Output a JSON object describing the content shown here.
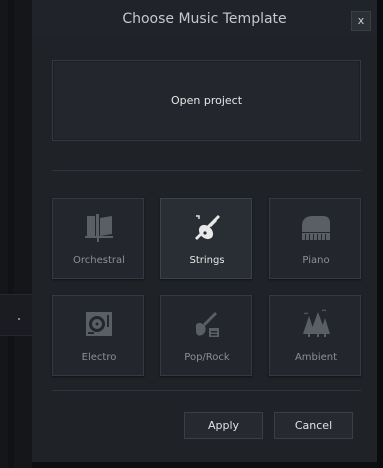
{
  "dialog": {
    "title": "Choose Music Template",
    "close_label": "x",
    "open_project_label": "Open project"
  },
  "templates": [
    {
      "label": "Orchestral",
      "icon": "orchestral-icon",
      "selected": false
    },
    {
      "label": "Strings",
      "icon": "violin-icon",
      "selected": true
    },
    {
      "label": "Piano",
      "icon": "piano-icon",
      "selected": false
    },
    {
      "label": "Electro",
      "icon": "turntable-icon",
      "selected": false
    },
    {
      "label": "Pop/Rock",
      "icon": "electric-guitar-icon",
      "selected": false
    },
    {
      "label": "Ambient",
      "icon": "forest-icon",
      "selected": false
    }
  ],
  "buttons": {
    "apply_label": "Apply",
    "cancel_label": "Cancel"
  },
  "colors": {
    "dialog_bg": "#1f2227",
    "tile_bg": "#23272d",
    "icon_dim": "#5a5f66",
    "icon_selected": "#e8e8e8"
  }
}
